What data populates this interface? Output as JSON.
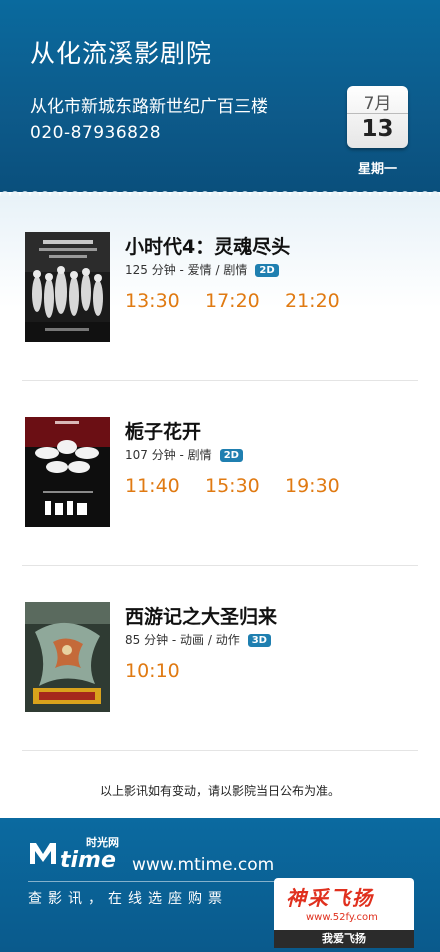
{
  "header": {
    "cinema_name": "从化流溪影剧院",
    "address": "从化市新城东路新世纪广百三楼",
    "phone": "020-87936828",
    "date": {
      "month": "7月",
      "day": "13",
      "weekday": "星期一"
    }
  },
  "movies": [
    {
      "title": "小时代4：灵魂尽头",
      "meta": "125 分钟 - 爱情 / 剧情",
      "format": "2D",
      "times": [
        "13:30",
        "17:20",
        "21:20"
      ]
    },
    {
      "title": "栀子花开",
      "meta": "107 分钟 - 剧情",
      "format": "2D",
      "times": [
        "11:40",
        "15:30",
        "19:30"
      ]
    },
    {
      "title": "西游记之大圣归来",
      "meta": "85 分钟 - 动画 / 动作",
      "format": "3D",
      "times": [
        "10:10"
      ]
    }
  ],
  "notice": "以上影讯如有变动，请以影院当日公布为准。",
  "footer": {
    "logo_text": "time",
    "logo_cn": "时光网",
    "site": "www.mtime.com",
    "slogan": "查影讯，在线选座购票",
    "watermark_title": "神采飞扬",
    "watermark_url": "www.52fy.com",
    "watermark_sub": "我爱飞扬"
  },
  "colors": {
    "header_bg": "#0a5a8c",
    "showtime": "#e07a12",
    "badge": "#1f7fb0"
  }
}
